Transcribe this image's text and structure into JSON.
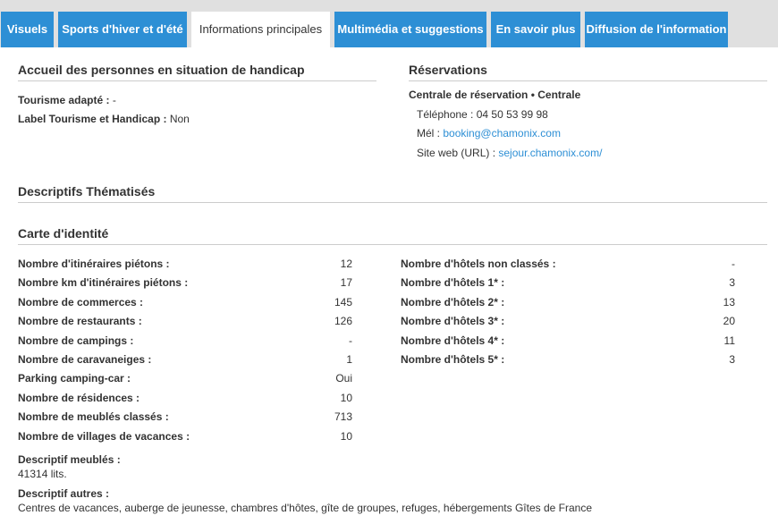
{
  "tabs": [
    {
      "label": "Visuels",
      "active": false
    },
    {
      "label": "Sports d'hiver et d'été",
      "active": false
    },
    {
      "label": "Informations principales",
      "active": true
    },
    {
      "label": "Multimédia et suggestions",
      "active": false
    },
    {
      "label": "En savoir plus",
      "active": false
    },
    {
      "label": "Diffusion de l'information",
      "active": false
    }
  ],
  "handicap": {
    "title": "Accueil des personnes en situation de handicap",
    "tourisme_adapte_label": "Tourisme adapté :",
    "tourisme_adapte_value": "-",
    "label_th_label": "Label Tourisme et Handicap :",
    "label_th_value": "Non"
  },
  "reservations": {
    "title": "Réservations",
    "centrale": "Centrale de réservation • Centrale",
    "phone_label": "Téléphone :",
    "phone_value": "04 50 53 99 98",
    "email_label": "Mél :",
    "email_value": "booking@chamonix.com",
    "web_label": "Site web (URL) :",
    "web_value": "sejour.chamonix.com/"
  },
  "descriptifs_title": "Descriptifs Thématisés",
  "identity": {
    "title": "Carte d'identité",
    "left": [
      {
        "label": "Nombre d'itinéraires piétons :",
        "value": "12"
      },
      {
        "label": "Nombre km d'itinéraires piétons :",
        "value": "17"
      },
      {
        "label": "Nombre de commerces :",
        "value": "145"
      },
      {
        "label": "Nombre de restaurants :",
        "value": "126"
      },
      {
        "label": "Nombre de campings :",
        "value": "-"
      },
      {
        "label": "Nombre de caravaneiges :",
        "value": "1"
      },
      {
        "label": "Parking camping-car :",
        "value": "Oui"
      },
      {
        "label": "Nombre de résidences :",
        "value": "10"
      },
      {
        "label": "Nombre de meublés classés :",
        "value": "713"
      },
      {
        "label": "Nombre de villages de vacances :",
        "value": "10"
      }
    ],
    "right": [
      {
        "label": "Nombre d'hôtels non classés :",
        "value": "-"
      },
      {
        "label": "Nombre d'hôtels 1* :",
        "value": "3"
      },
      {
        "label": "Nombre d'hôtels 2* :",
        "value": "13"
      },
      {
        "label": "Nombre d'hôtels 3* :",
        "value": "20"
      },
      {
        "label": "Nombre d'hôtels 4* :",
        "value": "11"
      },
      {
        "label": "Nombre d'hôtels 5* :",
        "value": "3"
      }
    ],
    "meubles_label": "Descriptif meublés :",
    "meubles_value": "41314 lits.",
    "autres_label": "Descriptif autres :",
    "autres_value": "Centres de vacances, auberge de jeunesse, chambres d'hôtes, gîte de groupes, refuges, hébergements Gîtes de France"
  },
  "colors": {
    "accent": "#2d8fd5",
    "tabbar": "#e0e0e0"
  }
}
